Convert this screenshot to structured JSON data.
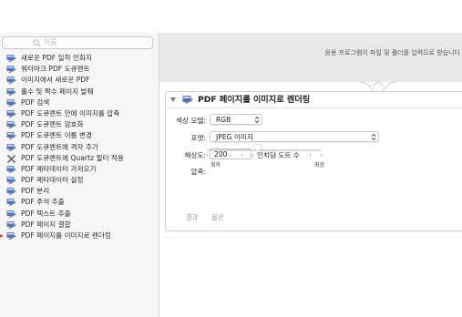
{
  "colors": {
    "sidebar_bg": "#f6f6f6",
    "drop_area_bg": "#e9e9e9",
    "selection_marker": "#d94a3b",
    "icon_blue": "#4b74c9"
  },
  "search": {
    "placeholder": "이름",
    "icon": "search-icon"
  },
  "actions": [
    {
      "label": "새로운 PDF 일착 인화지",
      "icon": "automator-action-icon"
    },
    {
      "label": "워터마크 PDF 도큐멘트",
      "icon": "automator-action-icon"
    },
    {
      "label": "이미지에서 새로운 PDF",
      "icon": "automator-action-icon"
    },
    {
      "label": "홀수 및 짝수 페이지 발췌",
      "icon": "automator-action-icon"
    },
    {
      "label": "PDF 검색",
      "icon": "automator-action-icon"
    },
    {
      "label": "PDF 도큐멘트 안에 이미지를 압축",
      "icon": "automator-action-icon"
    },
    {
      "label": "PDF 도큐멘트 암호화",
      "icon": "automator-action-icon"
    },
    {
      "label": "PDF 도큐멘트 이름 변경",
      "icon": "automator-action-icon"
    },
    {
      "label": "PDF 도큐멘트에 격자 추가",
      "icon": "automator-action-icon"
    },
    {
      "label": "PDF 도큐멘트에 Quartz 필터 적용",
      "icon": "quartz-tools-icon"
    },
    {
      "label": "PDF 메타데이터 가져오기",
      "icon": "automator-action-icon"
    },
    {
      "label": "PDF 메타데이터 설정",
      "icon": "automator-action-icon"
    },
    {
      "label": "PDF 분리",
      "icon": "automator-action-icon"
    },
    {
      "label": "PDF 주석 추출",
      "icon": "automator-action-icon"
    },
    {
      "label": "PDF 텍스트 추출",
      "icon": "automator-action-icon"
    },
    {
      "label": "PDF 페이지 결합",
      "icon": "automator-action-icon"
    },
    {
      "label": "PDF 페이지를 이미지로 렌더링",
      "icon": "automator-action-icon",
      "selected": true
    }
  ],
  "workflow": {
    "drop_hint": "응용 프로그램이 파일 및 폴더를 입력으로 받습니다"
  },
  "panel": {
    "title": "PDF 페이지를 이미지로 렌더링",
    "color_model_label": "색상 모델:",
    "color_model_value": "RGB",
    "format_label": "포맷:",
    "format_value": "JPEG 이미지",
    "resolution_label": "해상도:",
    "resolution_value": "200",
    "resolution_unit": "인치당 도트 수",
    "compression_label": "압축:",
    "compression_level": 0.45,
    "compression_min": "최하",
    "compression_max": "최상",
    "results_label": "결과",
    "options_label": "옵션"
  }
}
